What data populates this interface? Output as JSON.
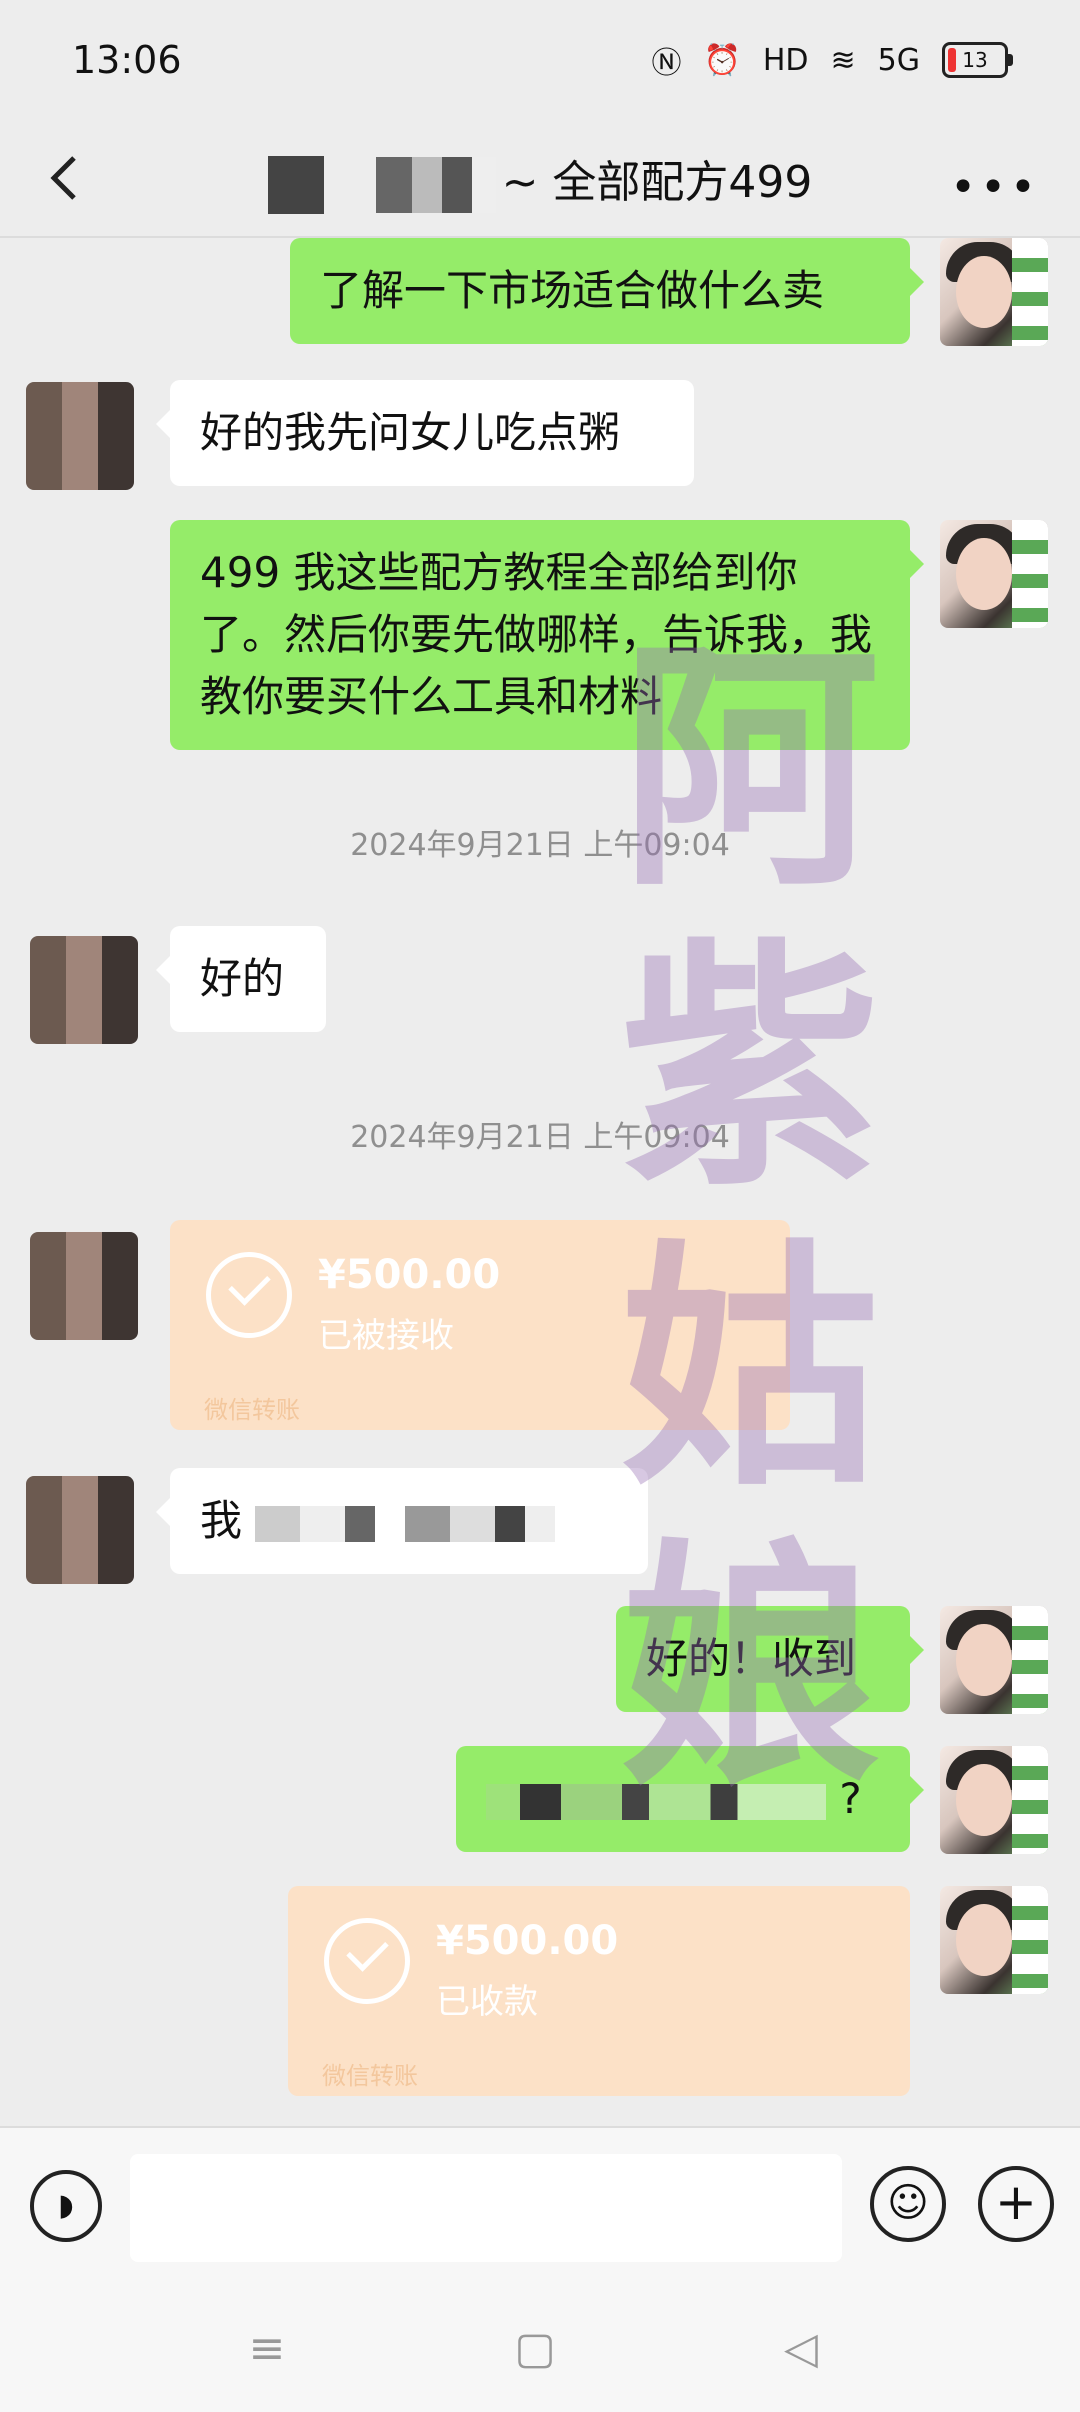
{
  "status_bar": {
    "time": "13:06",
    "battery": "13",
    "network": "5G"
  },
  "header": {
    "title": "~ 全部配方499",
    "back_icon": "back-arrow-icon",
    "more_icon": "more-dots-icon"
  },
  "messages": {
    "m1": "了解一下市场适合做什么卖",
    "m2": "好的我先问女儿吃点粥",
    "m3": "499 我这些配方教程全部给到你了。然后你要先做哪样，告诉我，我教你要买什么工具和材料",
    "ts1": "2024年9月21日 上午09:04",
    "m4": "好的",
    "ts2": "2024年9月21日 上午09:04",
    "transfer1": {
      "amount": "¥500.00",
      "status": "已被接收",
      "label": "微信转账"
    },
    "m5_start": "我",
    "m6": "好的！收到",
    "m7_end": "?",
    "transfer2": {
      "amount": "¥500.00",
      "status": "已收款",
      "label": "微信转账"
    }
  },
  "watermark": "阿紫姑娘",
  "input_bar": {
    "voice_icon": "voice-icon",
    "emoji_icon": "emoji-icon",
    "plus_icon": "plus-icon"
  },
  "nav_bar": {
    "menu_icon": "menu-icon",
    "home_icon": "home-square-icon",
    "back_icon": "back-triangle-icon"
  }
}
